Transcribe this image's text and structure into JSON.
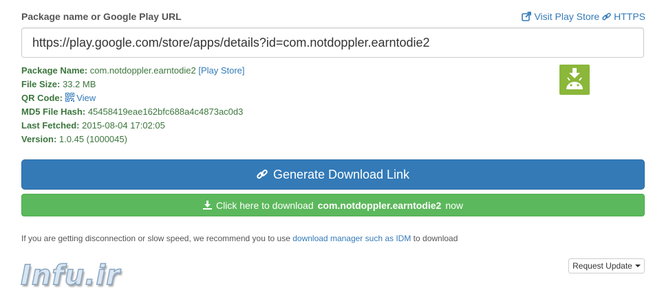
{
  "header": {
    "input_label": "Package name or Google Play URL",
    "visit_store_label": "Visit Play Store",
    "https_label": "HTTPS"
  },
  "url_input": {
    "value": "https://play.google.com/store/apps/details?id=com.notdoppler.earntodie2"
  },
  "package_info": {
    "package_name_label": "Package Name:",
    "package_name_value": "com.notdoppler.earntodie2",
    "play_store_link": "[Play Store]",
    "file_size_label": "File Size:",
    "file_size_value": "33.2 MB",
    "qr_code_label": "QR Code:",
    "qr_view_link": "View",
    "md5_label": "MD5 File Hash:",
    "md5_value": "45458419eae162bfc688a4c4873ac0d3",
    "last_fetched_label": "Last Fetched:",
    "last_fetched_value": "2015-08-04 17:02:05",
    "version_label": "Version:",
    "version_value": "1.0.45 (1000045)"
  },
  "buttons": {
    "generate_label": "Generate Download Link",
    "download_prefix": "Click here to download",
    "download_package": "com.notdoppler.earntodie2",
    "download_suffix": "now",
    "request_update_label": "Request Update"
  },
  "note": {
    "prefix": "If you are getting disconnection or slow speed, we recommend you to use",
    "link": "download manager such as IDM",
    "suffix": "to download"
  },
  "watermark": {
    "text": "Infu.ir"
  },
  "colors": {
    "primary": "#337ab7",
    "success": "#5cb85c",
    "info_text": "#3c763d",
    "android_green": "#8bb73a"
  }
}
